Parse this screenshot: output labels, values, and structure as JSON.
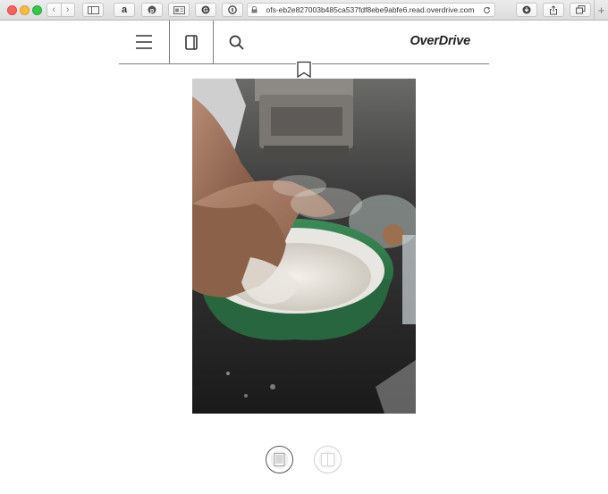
{
  "browser": {
    "url": "ofs-eb2e827003b485ca537fdf8ebe9abfe6.read.overdrive.com",
    "toolbar_icons": [
      "sidebar-icon",
      "amazon-icon",
      "pinterest-icon",
      "reader-icon",
      "grammarly-icon",
      "info-icon",
      "download-icon",
      "share-icon",
      "tabs-icon"
    ],
    "amazon_label": "a",
    "new_tab_label": "+"
  },
  "reader": {
    "brand": "OverDrive",
    "toolbar_icons": [
      "menu-icon",
      "book-icon",
      "search-icon",
      "bookmark-icon"
    ]
  },
  "page": {
    "image_subject": "hands-kneading-dough-in-green-bowl"
  },
  "layout_toggles": [
    {
      "name": "single-page-view",
      "active": true
    },
    {
      "name": "two-page-view",
      "active": false
    }
  ],
  "colors": {
    "bowl_green": "#2f7a4a",
    "toolbar_line": "#7d7d7d"
  }
}
